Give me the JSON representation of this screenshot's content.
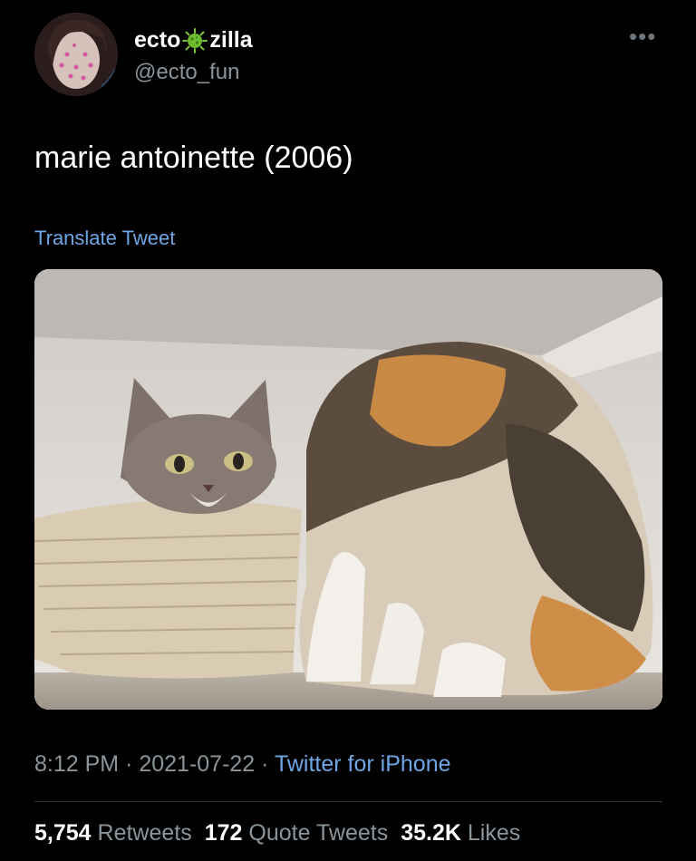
{
  "tweet": {
    "display_name_prefix": "ecto",
    "display_name_suffix": "zilla",
    "display_name_emoji": "virus-icon",
    "handle": "@ecto_fun",
    "more_label": "•••",
    "text": "marie antoinette (2006)",
    "translate_label": "Translate Tweet",
    "time": "8:12 PM",
    "date": "2021-07-22",
    "separator": " · ",
    "source": "Twitter for iPhone",
    "stats": {
      "retweets_count": "5,754",
      "retweets_label": "Retweets",
      "quotes_count": "172",
      "quotes_label": "Quote Tweets",
      "likes_count": "35.2K",
      "likes_label": "Likes"
    }
  },
  "colors": {
    "background": "#000000",
    "link": "#6ea6e6",
    "muted": "#8b949a",
    "divider": "#2f3336"
  }
}
